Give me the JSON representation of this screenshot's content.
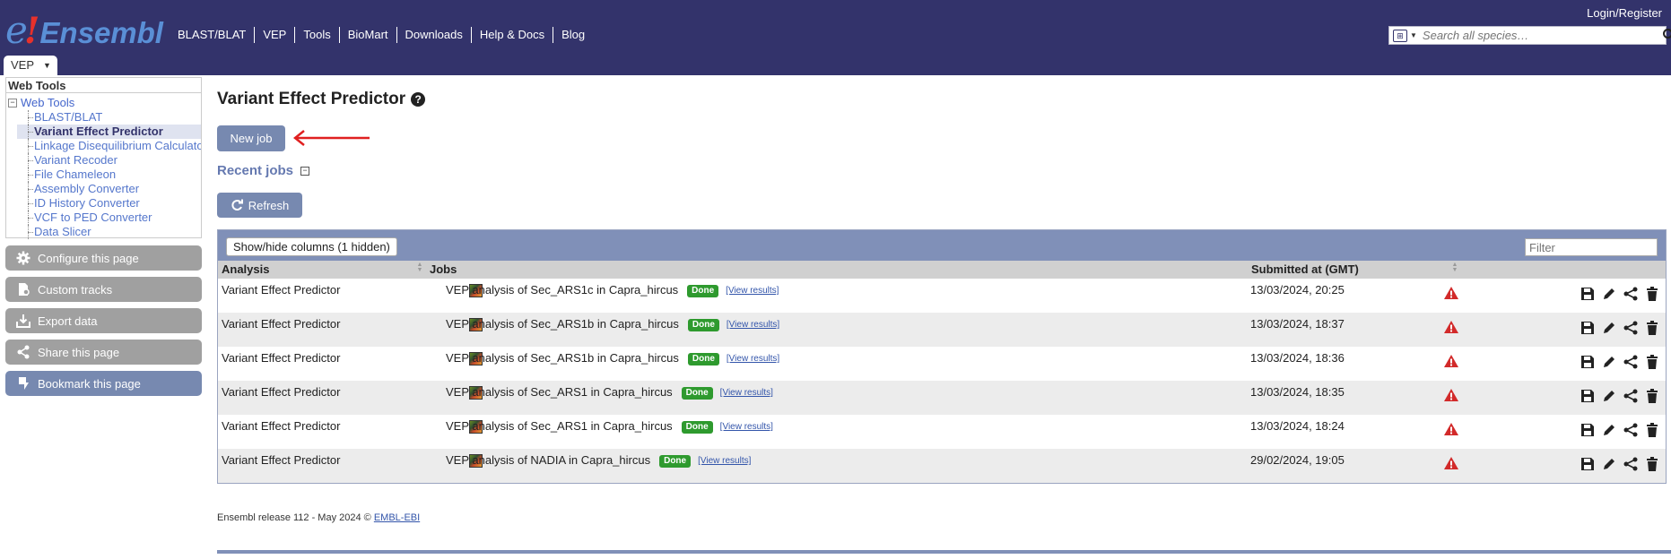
{
  "header": {
    "logo_e": "e",
    "logo_bang": "!",
    "logo_name": "Ensembl",
    "nav": [
      "BLAST/BLAT",
      "VEP",
      "Tools",
      "BioMart",
      "Downloads",
      "Help & Docs",
      "Blog"
    ],
    "login": "Login/Register",
    "search_placeholder": "Search all species…",
    "tab": "VEP"
  },
  "sidebar": {
    "tree_title": "Web Tools",
    "tree_root": "Web Tools",
    "items": [
      {
        "label": "BLAST/BLAT",
        "active": false
      },
      {
        "label": "Variant Effect Predictor",
        "active": true
      },
      {
        "label": "Linkage Disequilibrium Calculator",
        "active": false
      },
      {
        "label": "Variant Recoder",
        "active": false
      },
      {
        "label": "File Chameleon",
        "active": false
      },
      {
        "label": "Assembly Converter",
        "active": false
      },
      {
        "label": "ID History Converter",
        "active": false
      },
      {
        "label": "VCF to PED Converter",
        "active": false
      },
      {
        "label": "Data Slicer",
        "active": false
      }
    ],
    "buttons": [
      {
        "label": "Configure this page",
        "icon": "gear-icon"
      },
      {
        "label": "Custom tracks",
        "icon": "custom-tracks-icon"
      },
      {
        "label": "Export data",
        "icon": "export-icon"
      },
      {
        "label": "Share this page",
        "icon": "share-icon"
      },
      {
        "label": "Bookmark this page",
        "icon": "bookmark-icon"
      }
    ]
  },
  "main": {
    "title": "Variant Effect Predictor",
    "new_job": "New job",
    "recent_jobs": "Recent jobs",
    "refresh": "Refresh",
    "show_hide": "Show/hide columns (1 hidden)",
    "filter_placeholder": "Filter",
    "columns": [
      "Analysis",
      "Jobs",
      "Submitted at (GMT)"
    ],
    "status_label": "Done",
    "view_results": "[View results]",
    "rows": [
      {
        "analysis": "Variant Effect Predictor",
        "job": "VEP analysis of Sec_ARS1c in Capra_hircus",
        "submitted": "13/03/2024, 20:25"
      },
      {
        "analysis": "Variant Effect Predictor",
        "job": "VEP analysis of Sec_ARS1b in Capra_hircus",
        "submitted": "13/03/2024, 18:37"
      },
      {
        "analysis": "Variant Effect Predictor",
        "job": "VEP analysis of Sec_ARS1b in Capra_hircus",
        "submitted": "13/03/2024, 18:36"
      },
      {
        "analysis": "Variant Effect Predictor",
        "job": "VEP analysis of Sec_ARS1 in Capra_hircus",
        "submitted": "13/03/2024, 18:35"
      },
      {
        "analysis": "Variant Effect Predictor",
        "job": "VEP analysis of Sec_ARS1 in Capra_hircus",
        "submitted": "13/03/2024, 18:24"
      },
      {
        "analysis": "Variant Effect Predictor",
        "job": "VEP analysis of NADIA in Capra_hircus",
        "submitted": "29/02/2024, 19:05"
      }
    ]
  },
  "footer": {
    "text": "Ensembl release 112 - May 2024 © ",
    "link": "EMBL-EBI"
  },
  "colors": {
    "masthead": "#33336b",
    "accent_button": "#7789b0",
    "done_badge": "#2e9a2e",
    "warning": "#d22a2a"
  }
}
